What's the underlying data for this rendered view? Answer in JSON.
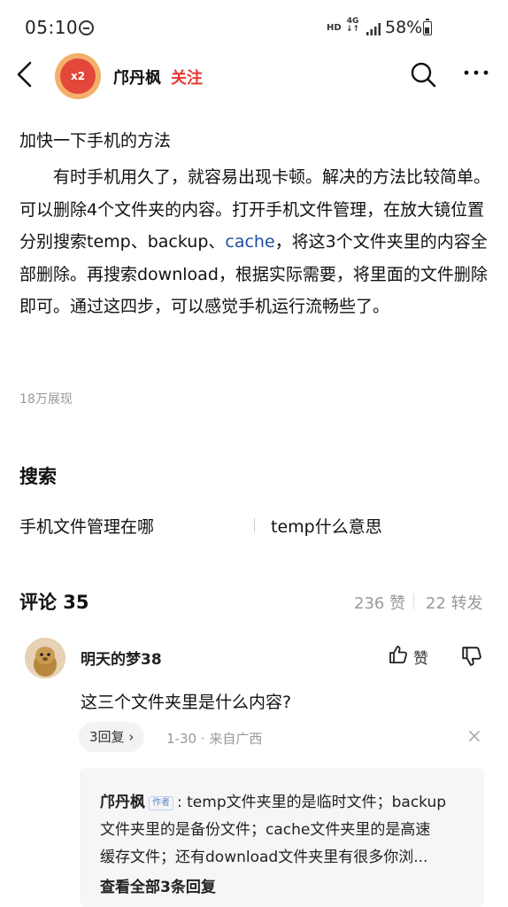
{
  "status_bar": {
    "time": "05:10",
    "network_hd": "HD",
    "network_gen": "4G",
    "battery_percent": "58%",
    "battery_level": 0.58
  },
  "header": {
    "author": "邝丹枫",
    "follow": "关注",
    "avatar_badge": "x2"
  },
  "article": {
    "title": "加快一下手机的方法",
    "body_before_link": "有时手机用久了，就容易出现卡顿。解决的方法比较简单。可以删除4个文件夹的内容。打开手机文件管理，在放大镜位置分别搜索temp、backup、",
    "body_link": "cache",
    "body_after_link": "，将这3个文件夹里的内容全部删除。再搜索download，根据实际需要，将里面的文件删除即可。通过这四步，可以感觉手机运行流畅些了。",
    "views": "18万展现"
  },
  "search": {
    "heading": "搜索",
    "items": [
      "手机文件管理在哪",
      "temp什么意思"
    ]
  },
  "comments": {
    "title": "评论 35",
    "likes": "236 赞",
    "shares": "22 转发",
    "list": [
      {
        "user": "明天的梦38",
        "like_label": "赞",
        "text": "这三个文件夹里是什么内容?",
        "reply_count": "3回复",
        "meta": "1-30 · 来自广西",
        "reply": {
          "author": "邝丹枫",
          "author_tag": "作者",
          "line1": ": temp文件夹里的是临时文件；backup",
          "line2": "文件夹里的是备份文件；cache文件夹里的是高速",
          "line3": "缓存文件；还有download文件夹里有很多你浏...",
          "view_all": "查看全部3条回复"
        }
      }
    ]
  }
}
